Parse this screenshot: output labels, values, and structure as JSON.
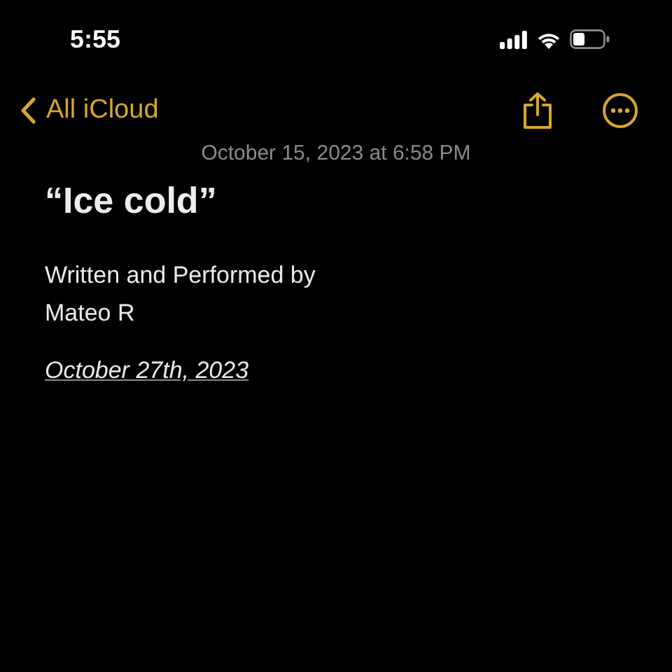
{
  "status_bar": {
    "time": "5:55"
  },
  "nav": {
    "back_label": "All iCloud"
  },
  "note": {
    "timestamp": "October 15, 2023 at 6:58 PM",
    "title": "“Ice cold”",
    "lines": [
      "Written and Performed by",
      "Mateo R"
    ],
    "date": "October 27th, 2023"
  }
}
